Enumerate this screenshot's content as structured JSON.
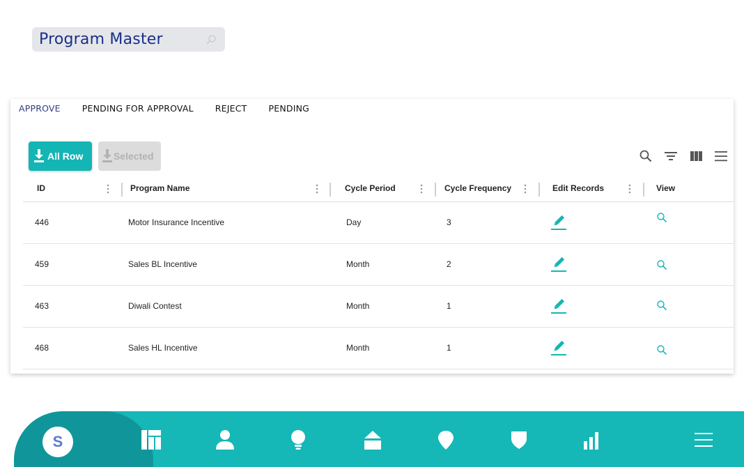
{
  "page": {
    "title": "Program Master"
  },
  "tabs": [
    {
      "label": "APPROVE",
      "active": true
    },
    {
      "label": "PENDING FOR APPROVAL",
      "active": false
    },
    {
      "label": "REJECT",
      "active": false
    },
    {
      "label": "PENDING",
      "active": false
    }
  ],
  "buttons": {
    "all_row": "All Row",
    "selected": "Selected"
  },
  "toolbar": [
    "search-icon",
    "filter-icon",
    "columns-icon",
    "menu-icon"
  ],
  "table": {
    "columns": [
      "ID",
      "Program Name",
      "Cycle Period",
      "Cycle Frequency",
      "Edit Records",
      "View"
    ],
    "rows": [
      {
        "id": "446",
        "name": "Motor Insurance Incentive",
        "period": "Day",
        "frequency": "3"
      },
      {
        "id": "459",
        "name": "Sales BL Incentive",
        "period": "Month",
        "frequency": "2"
      },
      {
        "id": "463",
        "name": "Diwali Contest",
        "period": "Month",
        "frequency": "1"
      },
      {
        "id": "468",
        "name": "Sales HL Incentive",
        "period": "Month",
        "frequency": "1"
      }
    ]
  },
  "bottom_nav": {
    "avatar_letter": "S",
    "items": [
      "dashboard-icon",
      "user-icon",
      "bulb-icon",
      "home-icon",
      "location-icon",
      "shield-icon",
      "bar-chart-icon",
      "hamburger-icon"
    ]
  },
  "colors": {
    "accent": "#14b5b5",
    "accent_dark": "#10969a",
    "title": "#1a2f8a",
    "active_tab": "#2f3f86"
  }
}
